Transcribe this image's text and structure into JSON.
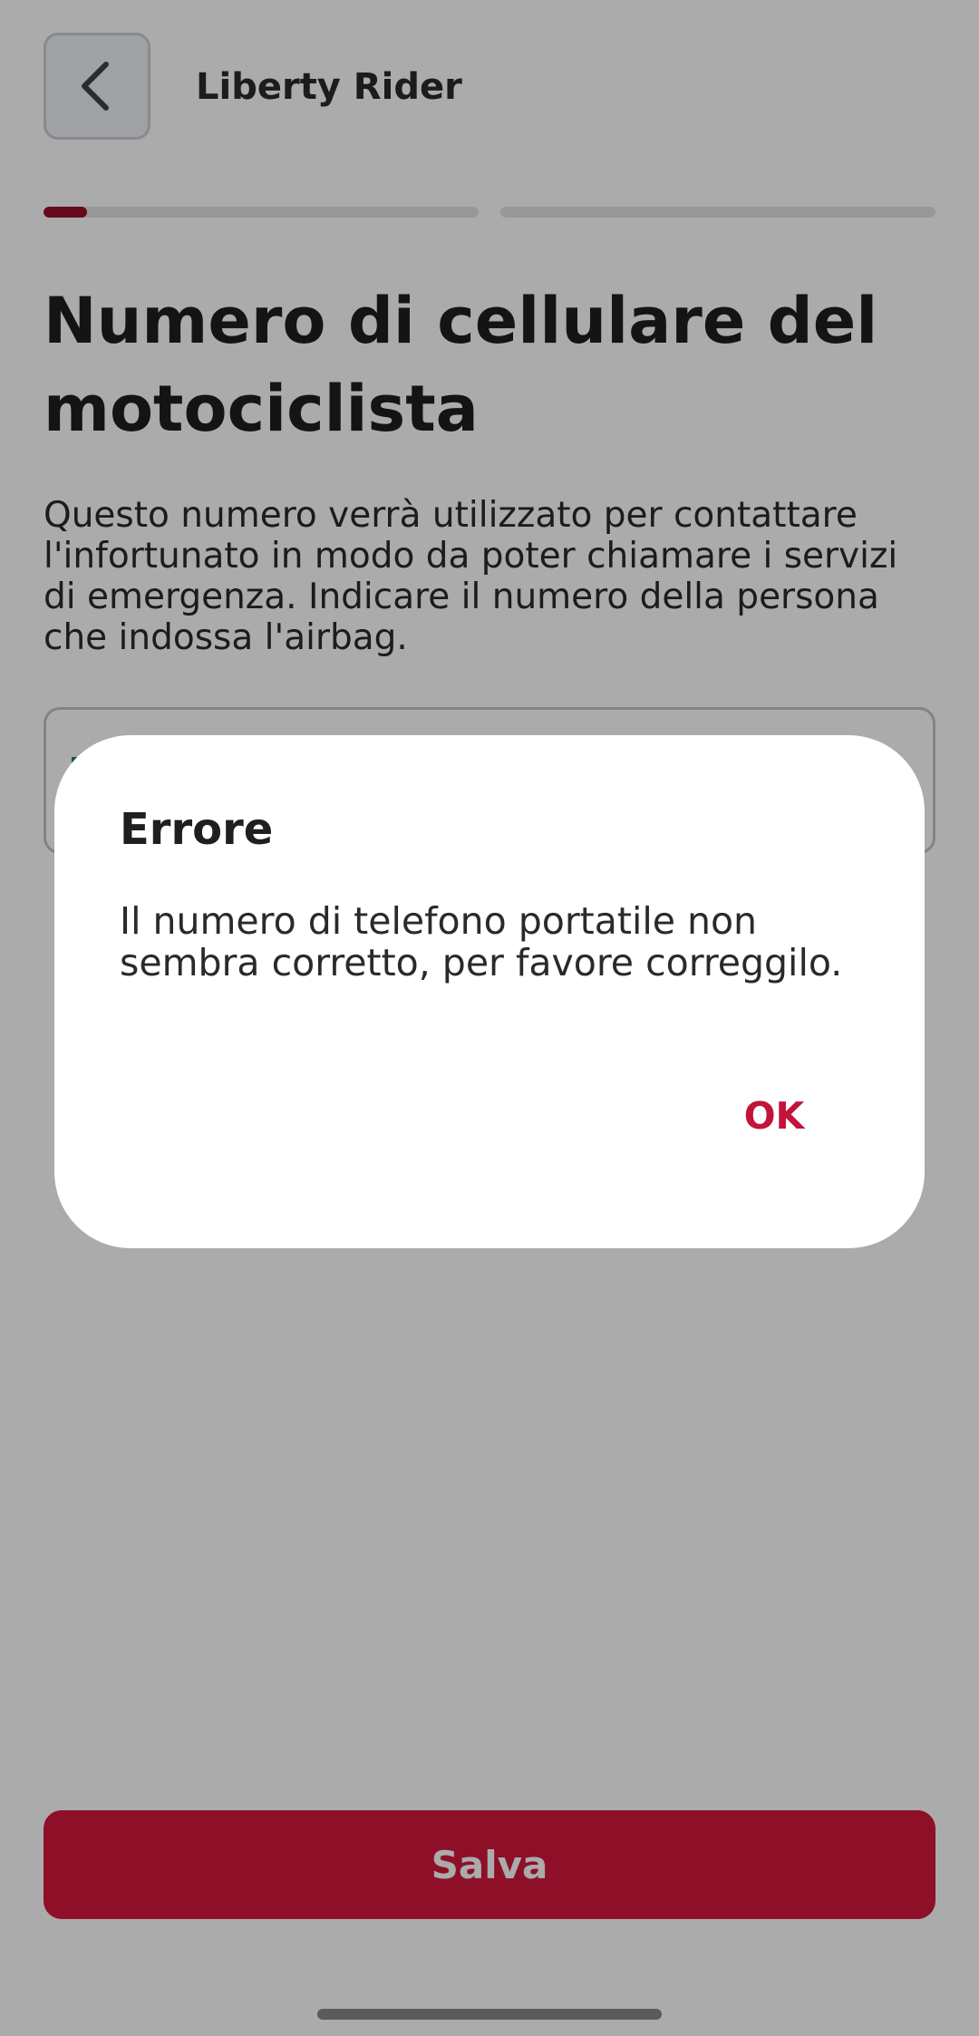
{
  "header": {
    "back_icon": "chevron-left-icon",
    "title": "Liberty Rider"
  },
  "progress": {
    "steps": [
      {
        "fill": 0.1
      },
      {
        "fill": 0
      }
    ]
  },
  "main": {
    "heading": "Numero di cellulare del motociclista",
    "description": "Questo numero verrà utilizzato per contattare l'infortunato in modo da poter chiamare i servizi di emergenza. Indicare il numero della persona che indossa l'airbag.",
    "phone_value": ""
  },
  "footer": {
    "save_label": "Salva"
  },
  "dialog": {
    "title": "Errore",
    "message": "Il numero di telefono portatile non sembra corretto, per favore correggilo.",
    "ok_label": "OK"
  },
  "colors": {
    "accent": "#D4193C",
    "accent_dark": "#9A102A",
    "dialog_button": "#C2133B",
    "overlay": "rgba(0,0,0,0.33)"
  }
}
